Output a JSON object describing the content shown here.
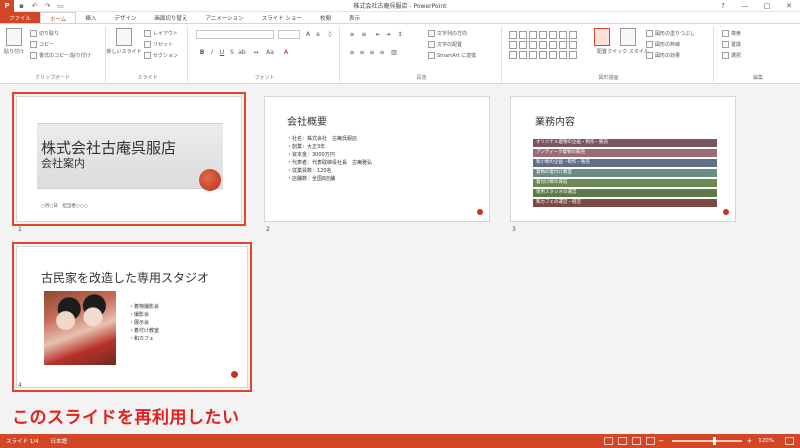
{
  "app": {
    "window_title": "株式会社古庵呉服店 - PowerPoint",
    "logo_letter": "P"
  },
  "quick_access": {
    "save_icon": "save-icon",
    "undo_icon": "undo-icon",
    "redo_icon": "redo-icon",
    "present_icon": "present-icon"
  },
  "window_controls": {
    "help": "?",
    "minimize": "—",
    "maximize": "□",
    "close": "✕"
  },
  "tabs": [
    {
      "label": "ファイル",
      "state": "file"
    },
    {
      "label": "ホーム",
      "state": "active"
    },
    {
      "label": "挿入",
      "state": ""
    },
    {
      "label": "デザイン",
      "state": ""
    },
    {
      "label": "画面切り替え",
      "state": ""
    },
    {
      "label": "アニメーション",
      "state": ""
    },
    {
      "label": "スライド ショー",
      "state": ""
    },
    {
      "label": "校閲",
      "state": ""
    },
    {
      "label": "表示",
      "state": ""
    }
  ],
  "ribbon": {
    "clipboard": {
      "group_label": "クリップボード",
      "paste": "貼り付け",
      "cut": "切り取り",
      "copy": "コピー",
      "format_painter": "書式のコピー/貼り付け"
    },
    "slides": {
      "group_label": "スライド",
      "new_slide": "新しいスライド",
      "layout": "レイアウト",
      "reset": "リセット",
      "section": "セクション"
    },
    "font": {
      "group_label": "フォント"
    },
    "paragraph": {
      "group_label": "段落",
      "text_direction": "文字列の方向",
      "align_text": "文字の配置",
      "smartart": "SmartArt に変換"
    },
    "drawing": {
      "group_label": "図形描画",
      "arrange": "配置",
      "quick_styles": "クイック スタイル",
      "shape_fill": "図形の塗りつぶし",
      "shape_outline": "図形の枠線",
      "shape_effects": "図形の効果"
    },
    "editing": {
      "group_label": "編集",
      "find": "検索",
      "replace": "置換",
      "select": "選択"
    }
  },
  "slides": [
    {
      "number": "1",
      "title": "株式会社古庵呉服店",
      "subtitle": "会社案内",
      "date": "○月○日　担当者○○○"
    },
    {
      "number": "2",
      "title": "会社概要",
      "bullets": [
        "・社名：株式会社　古庵呉服店",
        "・創業：大正3年",
        "・資本金：3000万円",
        "・代表者：代表取締役社長　古庵雅弘",
        "・従業員数：120名",
        "・店舗数：全国8店舗"
      ]
    },
    {
      "number": "3",
      "title": "業務内容",
      "bars": [
        {
          "text": "オリジナル着物の企画・制作・販売",
          "color": "#7a5663"
        },
        {
          "text": "アンティーク着物の販売",
          "color": "#9a6d76"
        },
        {
          "text": "和小物の企画・制作・販売",
          "color": "#5e6f86"
        },
        {
          "text": "着物の着付け教室",
          "color": "#6b8b86"
        },
        {
          "text": "着付け師の育成",
          "color": "#6a8a52"
        },
        {
          "text": "専用スタジオの運営",
          "color": "#5f7a4a"
        },
        {
          "text": "和カフェの運営・経営",
          "color": "#7d4a43"
        }
      ]
    },
    {
      "number": "4",
      "title": "古民家を改造した専用スタジオ",
      "bullets": [
        "・着物撮影会",
        "・撮影会",
        "・展示会",
        "・着付け教室",
        "・和カフェ"
      ]
    }
  ],
  "annotation": "このスライドを再利用したい",
  "statusbar": {
    "slide_info": "スライド 1/4",
    "language": "日本語",
    "zoom": "120%",
    "zoom_fraction": 0.6
  }
}
